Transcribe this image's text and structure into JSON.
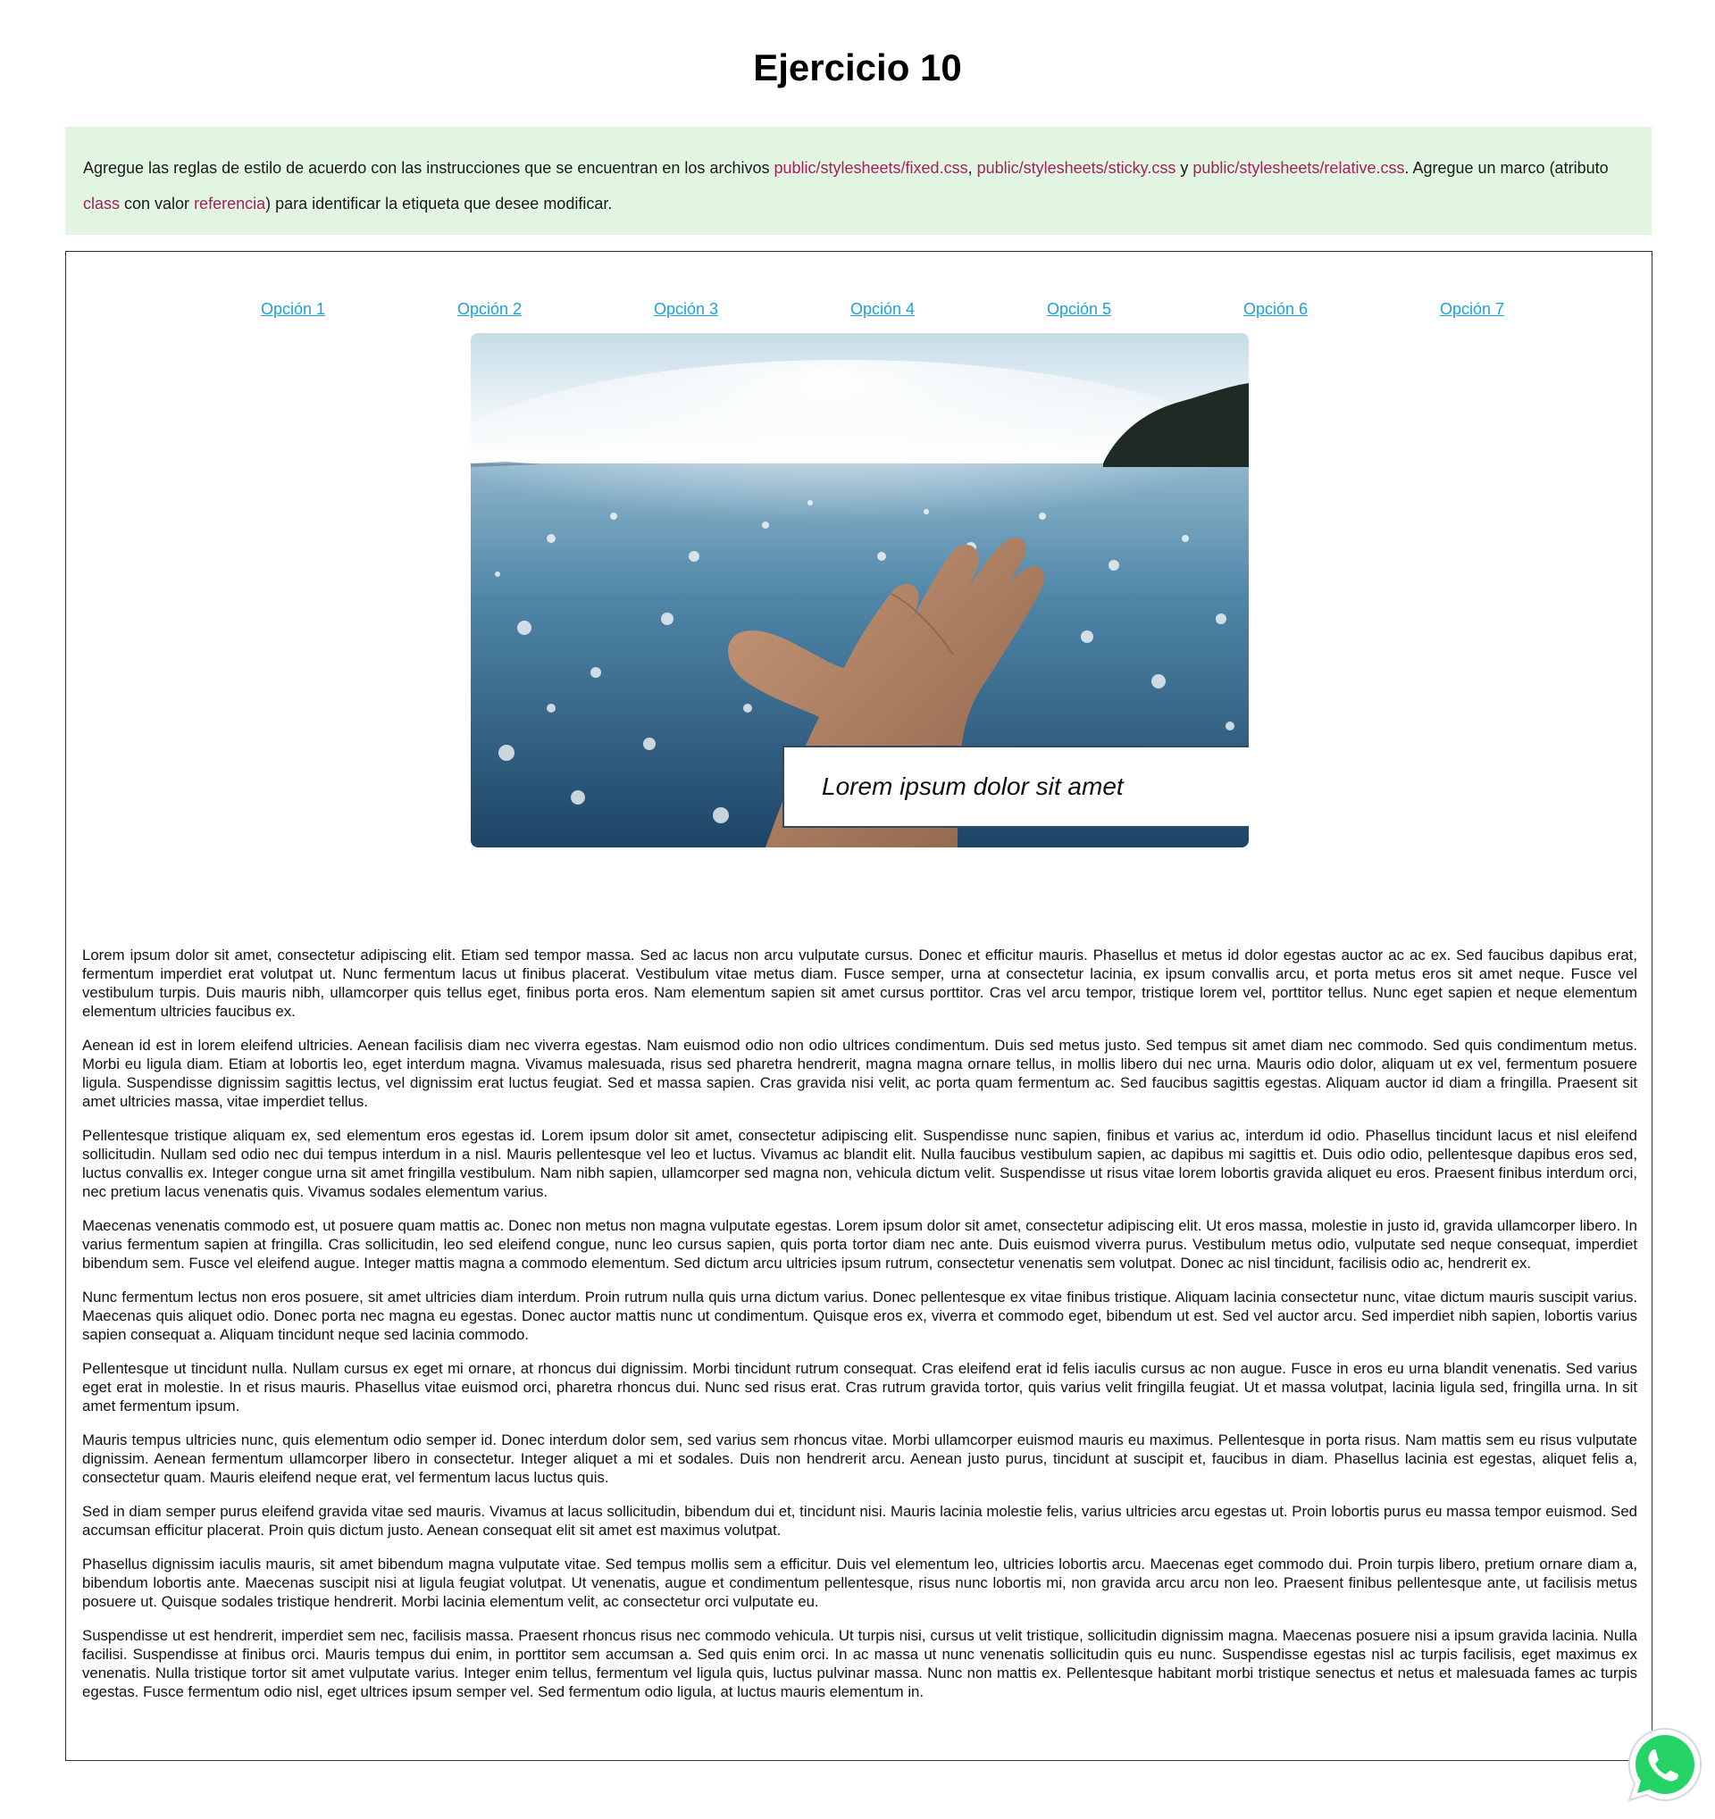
{
  "header": {
    "title": "Ejercicio 10"
  },
  "instructions": {
    "t1": "Agregue las reglas de estilo de acuerdo con las instrucciones que se encuentran en los archivos ",
    "file1": "public/stylesheets/fixed.css",
    "sep1": ", ",
    "file2": "public/stylesheets/sticky.css",
    "sep2": " y ",
    "file3": "public/stylesheets/relative.css",
    "t2": ". Agregue un marco (atributo ",
    "attr": "class",
    "t3": " con valor ",
    "value": "referencia",
    "t4": ") para identificar la etiqueta que desee modificar."
  },
  "nav": {
    "items": [
      "Opción 1",
      "Opción 2",
      "Opción 3",
      "Opción 4",
      "Opción 5",
      "Opción 6",
      "Opción 7"
    ]
  },
  "hero": {
    "caption": "Lorem ipsum dolor sit amet"
  },
  "content": {
    "paragraphs": [
      "Lorem ipsum dolor sit amet, consectetur adipiscing elit. Etiam sed tempor massa. Sed ac lacus non arcu vulputate cursus. Donec et efficitur mauris. Phasellus et metus id dolor egestas auctor ac ac ex. Sed faucibus dapibus erat, fermentum imperdiet erat volutpat ut. Nunc fermentum lacus ut finibus placerat. Vestibulum vitae metus diam. Fusce semper, urna at consectetur lacinia, ex ipsum convallis arcu, et porta metus eros sit amet neque. Fusce vel vestibulum turpis. Duis mauris nibh, ullamcorper quis tellus eget, finibus porta eros. Nam elementum sapien sit amet cursus porttitor. Cras vel arcu tempor, tristique lorem vel, porttitor tellus. Nunc eget sapien et neque elementum elementum ultricies faucibus ex.",
      "Aenean id est in lorem eleifend ultricies. Aenean facilisis diam nec viverra egestas. Nam euismod odio non odio ultrices condimentum. Duis sed metus justo. Sed tempus sit amet diam nec commodo. Sed quis condimentum metus. Morbi eu ligula diam. Etiam at lobortis leo, eget interdum magna. Vivamus malesuada, risus sed pharetra hendrerit, magna magna ornare tellus, in mollis libero dui nec urna. Mauris odio dolor, aliquam ut ex vel, fermentum posuere ligula. Suspendisse dignissim sagittis lectus, vel dignissim erat luctus feugiat. Sed et massa sapien. Cras gravida nisi velit, ac porta quam fermentum ac. Sed faucibus sagittis egestas. Aliquam auctor id diam a fringilla. Praesent sit amet ultricies massa, vitae imperdiet tellus.",
      "Pellentesque tristique aliquam ex, sed elementum eros egestas id. Lorem ipsum dolor sit amet, consectetur adipiscing elit. Suspendisse nunc sapien, finibus et varius ac, interdum id odio. Phasellus tincidunt lacus et nisl eleifend sollicitudin. Nullam sed odio nec dui tempus interdum in a nisl. Mauris pellentesque vel leo et luctus. Vivamus ac blandit elit. Nulla faucibus vestibulum sapien, ac dapibus mi sagittis et. Duis odio odio, pellentesque dapibus eros sed, luctus convallis ex. Integer congue urna sit amet fringilla vestibulum. Nam nibh sapien, ullamcorper sed magna non, vehicula dictum velit. Suspendisse ut risus vitae lorem lobortis gravida aliquet eu eros. Praesent finibus interdum orci, nec pretium lacus venenatis quis. Vivamus sodales elementum varius.",
      "Maecenas venenatis commodo est, ut posuere quam mattis ac. Donec non metus non magna vulputate egestas. Lorem ipsum dolor sit amet, consectetur adipiscing elit. Ut eros massa, molestie in justo id, gravida ullamcorper libero. In varius fermentum sapien at fringilla. Cras sollicitudin, leo sed eleifend congue, nunc leo cursus sapien, quis porta tortor diam nec ante. Duis euismod viverra purus. Vestibulum metus odio, vulputate sed neque consequat, imperdiet bibendum sem. Fusce vel eleifend augue. Integer mattis magna a commodo elementum. Sed dictum arcu ultricies ipsum rutrum, consectetur venenatis sem volutpat. Donec ac nisl tincidunt, facilisis odio ac, hendrerit ex.",
      "Nunc fermentum lectus non eros posuere, sit amet ultricies diam interdum. Proin rutrum nulla quis urna dictum varius. Donec pellentesque ex vitae finibus tristique. Aliquam lacinia consectetur nunc, vitae dictum mauris suscipit varius. Maecenas quis aliquet odio. Donec porta nec magna eu egestas. Donec auctor mattis nunc ut condimentum. Quisque eros ex, viverra et commodo eget, bibendum ut est. Sed vel auctor arcu. Sed imperdiet nibh sapien, lobortis varius sapien consequat a. Aliquam tincidunt neque sed lacinia commodo.",
      "Pellentesque ut tincidunt nulla. Nullam cursus ex eget mi ornare, at rhoncus dui dignissim. Morbi tincidunt rutrum consequat. Cras eleifend erat id felis iaculis cursus ac non augue. Fusce in eros eu urna blandit venenatis. Sed varius eget erat in molestie. In et risus mauris. Phasellus vitae euismod orci, pharetra rhoncus dui. Nunc sed risus erat. Cras rutrum gravida tortor, quis varius velit fringilla feugiat. Ut et massa volutpat, lacinia ligula sed, fringilla urna. In sit amet fermentum ipsum.",
      "Mauris tempus ultricies nunc, quis elementum odio semper id. Donec interdum dolor sem, sed varius sem rhoncus vitae. Morbi ullamcorper euismod mauris eu maximus. Pellentesque in porta risus. Nam mattis sem eu risus vulputate dignissim. Aenean fermentum ullamcorper libero in consectetur. Integer aliquet a mi et sodales. Duis non hendrerit arcu. Aenean justo purus, tincidunt at suscipit et, faucibus in diam. Phasellus lacinia est egestas, aliquet felis a, consectetur quam. Mauris eleifend neque erat, vel fermentum lacus luctus quis.",
      "Sed in diam semper purus eleifend gravida vitae sed mauris. Vivamus at lacus sollicitudin, bibendum dui et, tincidunt nisi. Mauris lacinia molestie felis, varius ultricies arcu egestas ut. Proin lobortis purus eu massa tempor euismod. Sed accumsan efficitur placerat. Proin quis dictum justo. Aenean consequat elit sit amet est maximus volutpat.",
      "Phasellus dignissim iaculis mauris, sit amet bibendum magna vulputate vitae. Sed tempus mollis sem a efficitur. Duis vel elementum leo, ultricies lobortis arcu. Maecenas eget commodo dui. Proin turpis libero, pretium ornare diam a, bibendum lobortis ante. Maecenas suscipit nisi at ligula feugiat volutpat. Ut venenatis, augue et condimentum pellentesque, risus nunc lobortis mi, non gravida arcu arcu non leo. Praesent finibus pellentesque ante, ut facilisis metus posuere ut. Quisque sodales tristique hendrerit. Morbi lacinia elementum velit, ac consectetur orci vulputate eu.",
      "Suspendisse ut est hendrerit, imperdiet sem nec, facilisis massa. Praesent rhoncus risus nec commodo vehicula. Ut turpis nisi, cursus ut velit tristique, sollicitudin dignissim magna. Maecenas posuere nisi a ipsum gravida lacinia. Nulla facilisi. Suspendisse at finibus orci. Mauris tempus dui enim, in porttitor sem accumsan a. Sed quis enim orci. In ac massa ut nunc venenatis sollicitudin quis eu nunc. Suspendisse egestas nisl ac turpis facilisis, eget maximus ex venenatis. Nulla tristique tortor sit amet vulputate varius. Integer enim tellus, fermentum vel ligula quis, luctus pulvinar massa. Nunc non mattis ex. Pellentesque habitant morbi tristique senectus et netus et malesuada fames ac turpis egestas. Fusce fermentum odio nisl, eget ultrices ipsum semper vel. Sed fermentum odio ligula, at luctus mauris elementum in."
    ]
  },
  "floating": {
    "icon": "whatsapp-icon",
    "color": "#25d366"
  }
}
